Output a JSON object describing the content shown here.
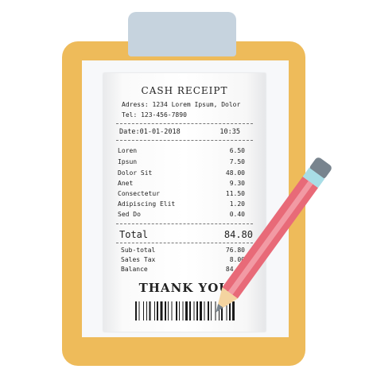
{
  "receipt": {
    "title": "CASH RECEIPT",
    "address": "Adress: 1234 Lorem Ipsum, Dolor",
    "tel": "Tel: 123-456-7890",
    "date": "Date:01-01-2018",
    "time": "10:35",
    "items": [
      {
        "name": "Loren",
        "value": "6.50"
      },
      {
        "name": "Ipsun",
        "value": "7.50"
      },
      {
        "name": "Dolor Sit",
        "value": "48.00"
      },
      {
        "name": "Anet",
        "value": "9.30"
      },
      {
        "name": "Consectetur",
        "value": "11.50"
      },
      {
        "name": "Adipiscing Elit",
        "value": "1.20"
      },
      {
        "name": "Sed Do",
        "value": "0.40"
      }
    ],
    "total_label": "Total",
    "total_value": "84.80",
    "summary": [
      {
        "name": "Sub-total",
        "value": "76.80"
      },
      {
        "name": "Sales Tax",
        "value": "8.00"
      },
      {
        "name": "Balance",
        "value": "84.80"
      }
    ],
    "thanks": "THANK YOU"
  },
  "colors": {
    "clipboard": "#eebb5a",
    "clip": "#c6d3de",
    "pencil_body": "#e86a78",
    "pencil_stripe": "#f29aa4",
    "pencil_band": "#a8dde6",
    "pencil_eraser": "#78848e",
    "pencil_tip": "#78848e"
  },
  "icons": [
    "clipboard-icon",
    "pencil-icon",
    "barcode-icon"
  ]
}
